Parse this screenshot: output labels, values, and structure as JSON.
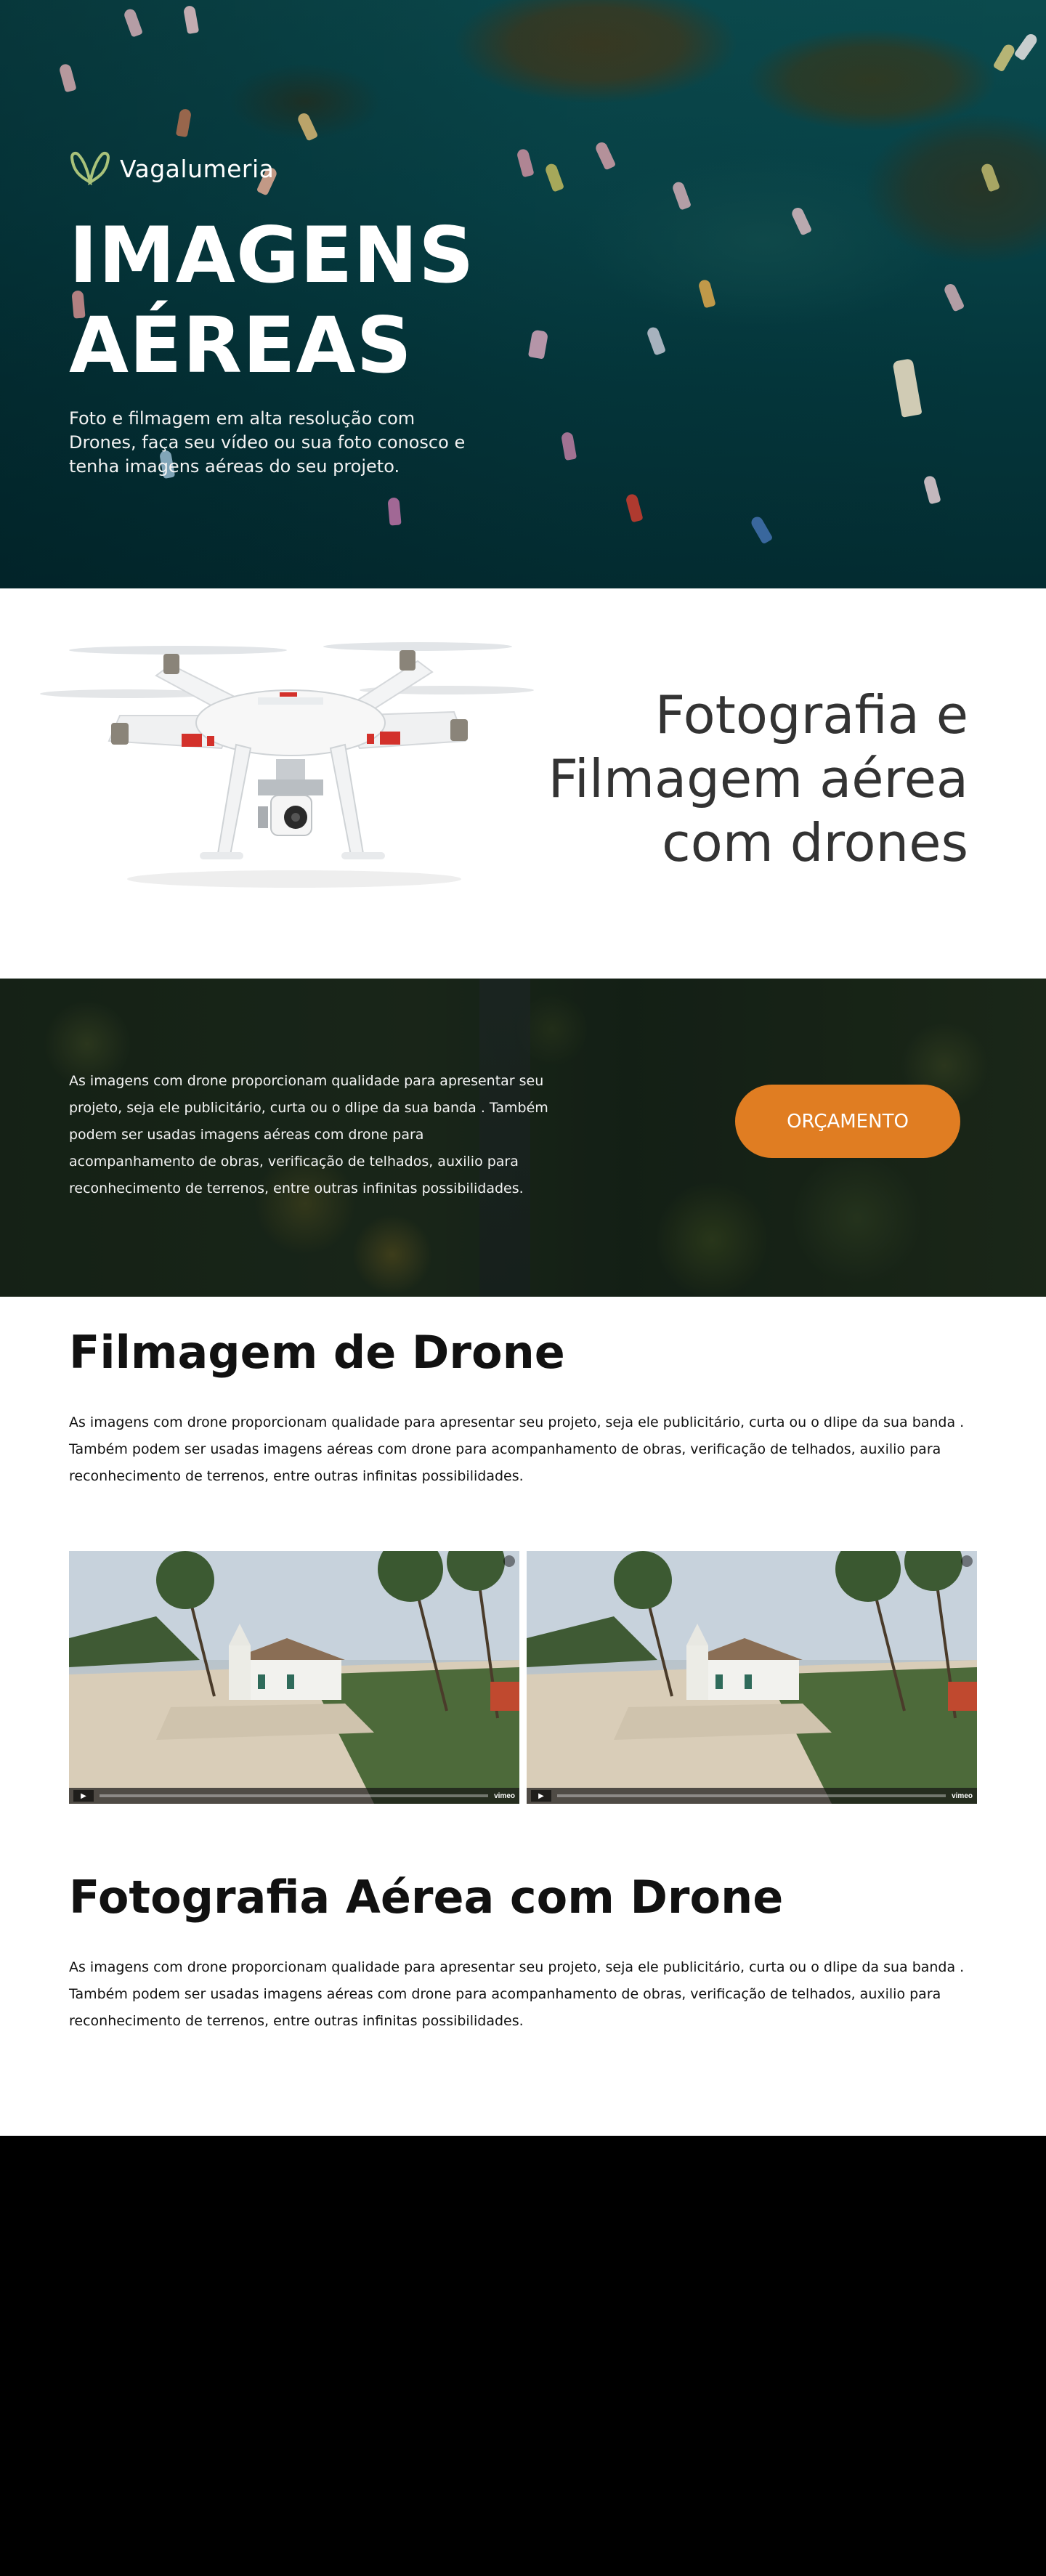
{
  "brand": {
    "name": "Vagalumeria",
    "logo_icon": "firefly-wings-icon",
    "logo_color": "#a9c27a"
  },
  "hero": {
    "title_line1": "IMAGENS",
    "title_line2": "AÉREAS",
    "subtitle": "Foto e filmagem em alta resolução com Drones, faça seu vídeo ou sua foto conosco e tenha imagens aéreas do seu projeto."
  },
  "intro": {
    "title_line1": "Fotografia e",
    "title_line2": "Filmagem aérea",
    "title_line3": "com drones",
    "image_icon": "drone-image"
  },
  "banner": {
    "text": "As imagens com drone proporcionam qualidade para apresentar seu projeto, seja ele publicitário, curta ou o dlipe da sua banda . Também podem ser usadas imagens aéreas com drone para acompanhamento de obras, verificação de telhados, auxilio para reconhecimento de terrenos, entre outras infinitas possibilidades.",
    "button_label": "ORÇAMENTO",
    "button_color": "#e07d22"
  },
  "filmagem": {
    "title": "Filmagem de Drone",
    "text": "As imagens com drone proporcionam qualidade para apresentar seu projeto, seja ele publicitário, curta ou o dlipe da sua banda . Também podem ser usadas imagens aéreas com drone para acompanhamento de obras, verificação de telhados, auxilio para reconhecimento de terrenos, entre outras infinitas possibilidades.",
    "videos": [
      {
        "provider": "vimeo",
        "play_icon": "play-icon"
      },
      {
        "provider": "vimeo",
        "play_icon": "play-icon"
      }
    ]
  },
  "fotografia": {
    "title": "Fotografia Aérea com Drone",
    "text": "As imagens com drone proporcionam qualidade para apresentar seu projeto, seja ele publicitário, curta ou o dlipe da sua banda . Também podem ser usadas imagens aéreas com drone para acompanhamento de obras, verificação de telhados, auxilio para reconhecimento de terrenos, entre outras infinitas possibilidades."
  }
}
